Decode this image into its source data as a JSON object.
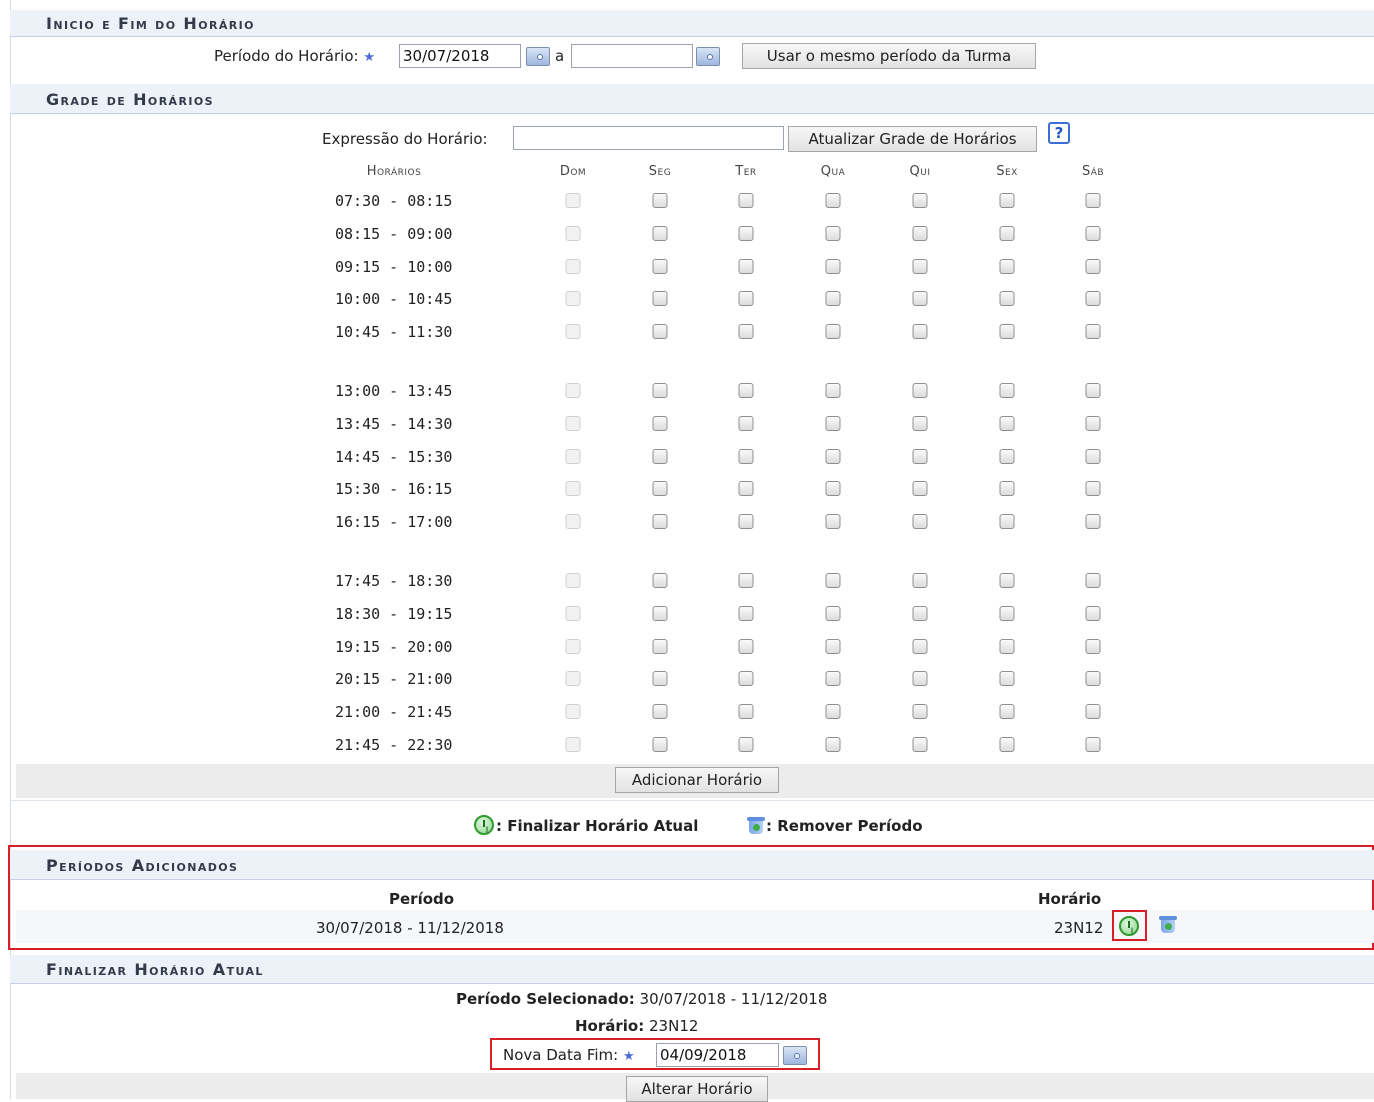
{
  "inicio_fim": {
    "title": "Inicio e Fim do Horário",
    "periodo_label": "Período do Horário:",
    "date_start": "30/07/2018",
    "date_between": "a",
    "date_end": "",
    "same_period_button": "Usar o mesmo período da Turma"
  },
  "grade": {
    "title": "Grade de Horários",
    "expressao_label": "Expressão do Horário:",
    "expressao_value": "",
    "update_button": "Atualizar Grade de Horários",
    "help_icon_glyph": "?",
    "columns": [
      "Horários",
      "Dom",
      "Seg",
      "Ter",
      "Qua",
      "Qui",
      "Sex",
      "Sáb"
    ],
    "rows": [
      "07:30 - 08:15",
      "08:15 - 09:00",
      "09:15 - 10:00",
      "10:00 - 10:45",
      "10:45 - 11:30",
      "13:00 - 13:45",
      "13:45 - 14:30",
      "14:45 - 15:30",
      "15:30 - 16:15",
      "16:15 - 17:00",
      "17:45 - 18:30",
      "18:30 - 19:15",
      "19:15 - 20:00",
      "20:15 - 21:00",
      "21:00 - 21:45",
      "21:45 - 22:30"
    ],
    "add_button": "Adicionar Horário"
  },
  "legend": {
    "finalize_text": ": Finalizar Horário Atual",
    "remove_text": ": Remover Período"
  },
  "periodos": {
    "title": "Períodos Adicionados",
    "col_periodo": "Período",
    "col_horario": "Horário",
    "row_periodo": "30/07/2018 - 11/12/2018",
    "row_horario": "23N12"
  },
  "finalizar": {
    "title": "Finalizar Horário Atual",
    "periodo_sel_label": "Período Selecionado:",
    "periodo_sel_value": "30/07/2018 - 11/12/2018",
    "horario_label": "Horário:",
    "horario_value": "23N12",
    "nova_data_label": "Nova Data Fim:",
    "nova_data_value": "04/09/2018",
    "alter_button": "Alterar Horário"
  },
  "colors": {
    "section_header_bg": "#edf2f9",
    "highlight_red": "#d71f28",
    "required_star": "#4a6bd8"
  }
}
